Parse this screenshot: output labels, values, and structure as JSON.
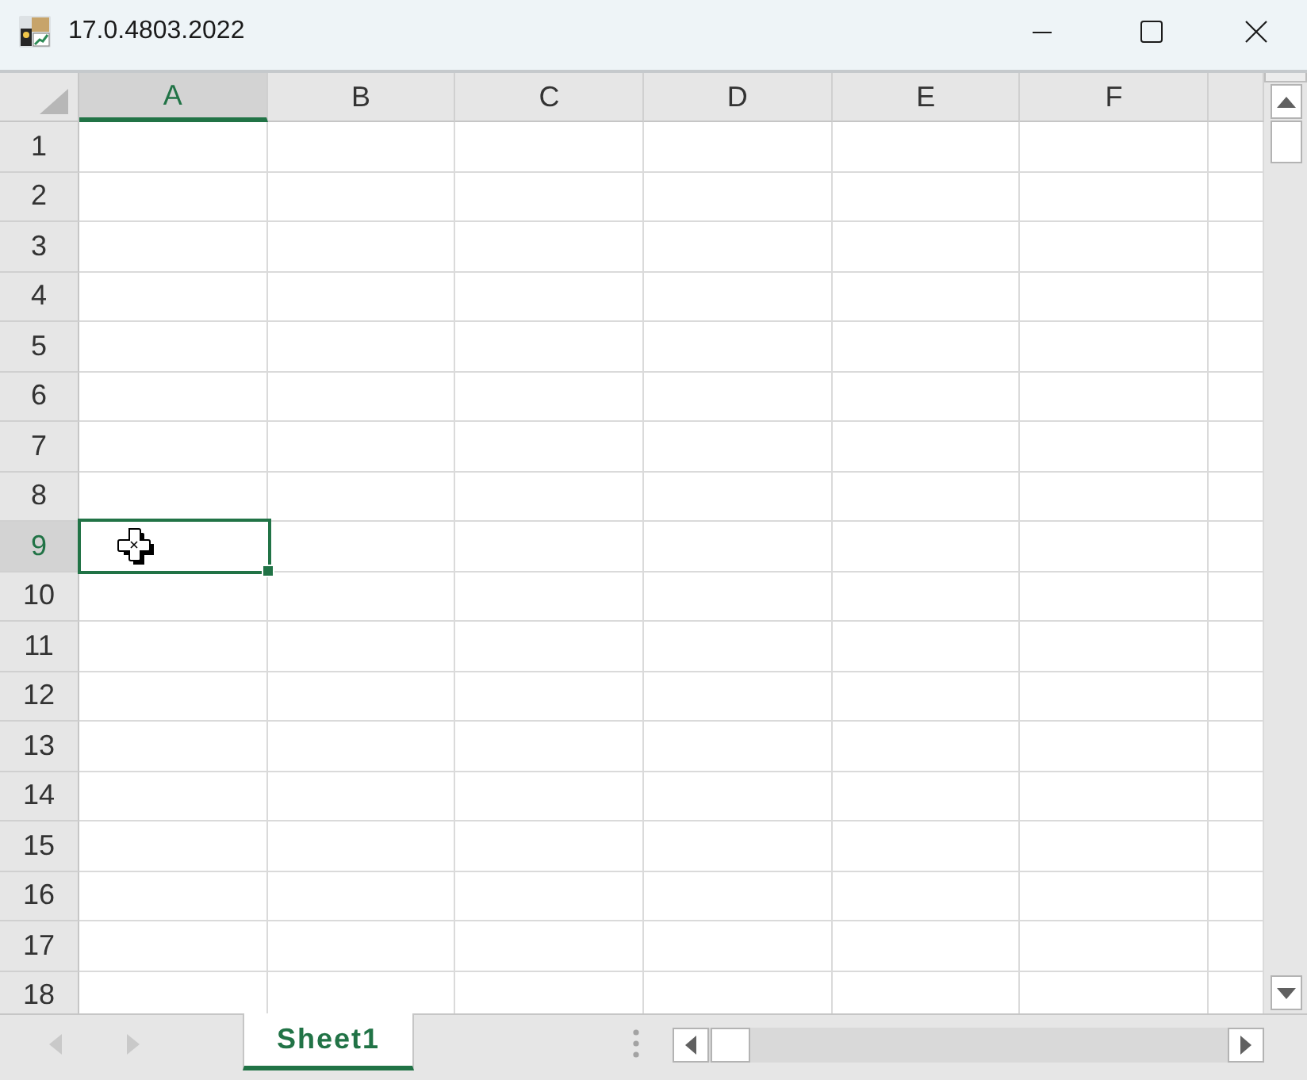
{
  "window": {
    "title": "17.0.4803.2022"
  },
  "sheet": {
    "columns": [
      {
        "label": "A",
        "selected": true
      },
      {
        "label": "B",
        "selected": false
      },
      {
        "label": "C",
        "selected": false
      },
      {
        "label": "D",
        "selected": false
      },
      {
        "label": "E",
        "selected": false
      },
      {
        "label": "F",
        "selected": false
      }
    ],
    "rows": [
      {
        "label": "1",
        "selected": false
      },
      {
        "label": "2",
        "selected": false
      },
      {
        "label": "3",
        "selected": false
      },
      {
        "label": "4",
        "selected": false
      },
      {
        "label": "5",
        "selected": false
      },
      {
        "label": "6",
        "selected": false
      },
      {
        "label": "7",
        "selected": false
      },
      {
        "label": "8",
        "selected": false
      },
      {
        "label": "9",
        "selected": true
      },
      {
        "label": "10",
        "selected": false
      },
      {
        "label": "11",
        "selected": false
      },
      {
        "label": "12",
        "selected": false
      },
      {
        "label": "13",
        "selected": false
      },
      {
        "label": "14",
        "selected": false
      },
      {
        "label": "15",
        "selected": false
      },
      {
        "label": "16",
        "selected": false
      },
      {
        "label": "17",
        "selected": false
      },
      {
        "label": "18",
        "selected": false
      }
    ]
  },
  "tab_bar": {
    "scroll_buttons": [
      {
        "kind": "previous",
        "disabled": true
      },
      {
        "kind": "next",
        "disabled": true
      }
    ],
    "tabs": [
      {
        "label": "Sheet1",
        "selected": true
      }
    ]
  }
}
